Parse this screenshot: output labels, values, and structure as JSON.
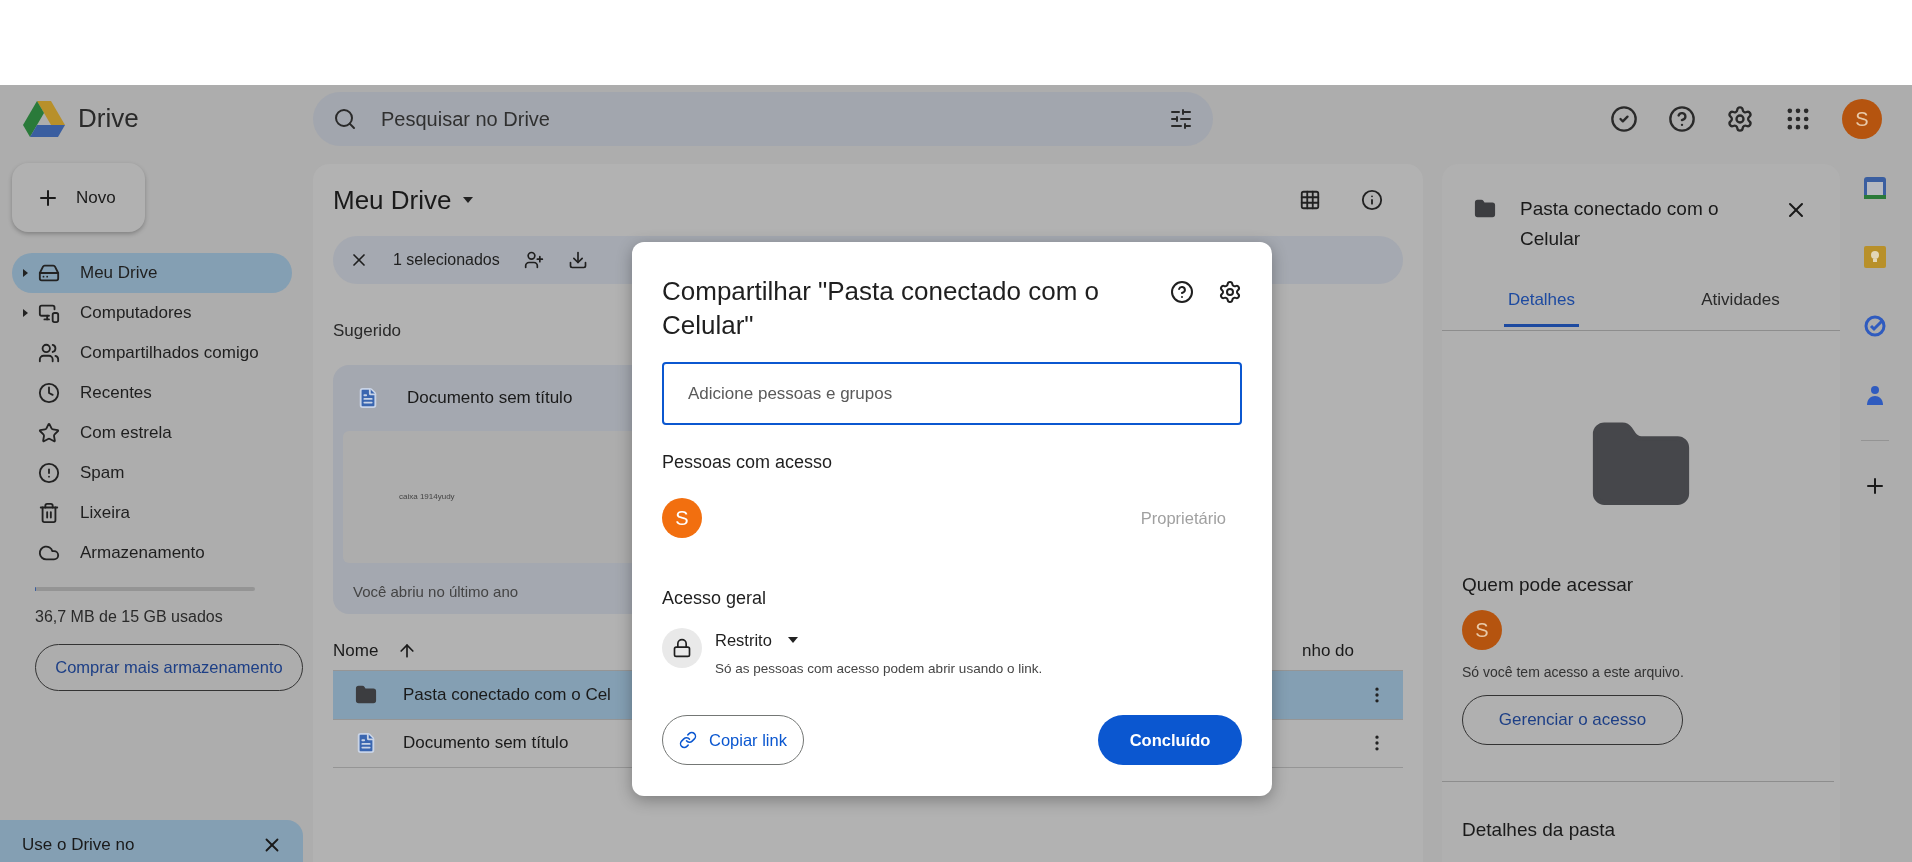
{
  "header": {
    "app_name": "Drive",
    "search": {
      "placeholder": "Pesquisar no Drive"
    },
    "avatar": "S"
  },
  "new_button": "Novo",
  "sidebar": {
    "items": [
      {
        "label": "Meu Drive",
        "selected": true,
        "expandable": true
      },
      {
        "label": "Computadores",
        "selected": false,
        "expandable": true
      },
      {
        "label": "Compartilhados comigo",
        "selected": false,
        "expandable": false
      },
      {
        "label": "Recentes",
        "selected": false,
        "expandable": false
      },
      {
        "label": "Com estrela",
        "selected": false,
        "expandable": false
      },
      {
        "label": "Spam",
        "selected": false,
        "expandable": false
      },
      {
        "label": "Lixeira",
        "selected": false,
        "expandable": false
      },
      {
        "label": "Armazenamento",
        "selected": false,
        "expandable": false
      }
    ],
    "storage": {
      "level": 0.003,
      "text": "36,7 MB de 15 GB usados"
    },
    "buy_button": "Comprar mais armazenamento",
    "banner": {
      "text": "Use o Drive no"
    }
  },
  "main": {
    "title": "Meu Drive",
    "selection": "1 selecionados",
    "suggested_label": "Sugerido",
    "card": {
      "title": "Documento sem título",
      "preview_text": "caixa 1914yudy",
      "footer": "Você abriu no último ano"
    },
    "columns": [
      "Nome",
      "nho do"
    ],
    "rows": [
      {
        "name": "Pasta conectado com o Cel",
        "kind": "folder",
        "selected": true
      },
      {
        "name": "Documento sem título",
        "kind": "doc",
        "selected": false
      }
    ]
  },
  "details": {
    "title": "Pasta conectado com o Celular",
    "tabs": [
      {
        "label": "Detalhes",
        "selected": true
      },
      {
        "label": "Atividades",
        "selected": false
      }
    ],
    "access_heading": "Quem pode acessar",
    "avatar": "S",
    "access_text": "Só você tem acesso a este arquivo.",
    "manage_button": "Gerenciar o acesso",
    "folder_details": "Detalhes da pasta"
  },
  "dialog": {
    "title": "Compartilhar \"Pasta conectado com o Celular\"",
    "input": {
      "placeholder": "Adicione pessoas e grupos"
    },
    "people_heading": "Pessoas com acesso",
    "people": [
      {
        "avatar": "S",
        "role": "Proprietário"
      }
    ],
    "general_heading": "Acesso geral",
    "access": {
      "label": "Restrito",
      "description": "Só as pessoas com acesso podem abrir usando o link."
    },
    "copy_button": "Copiar link",
    "done_button": "Concluído"
  }
}
